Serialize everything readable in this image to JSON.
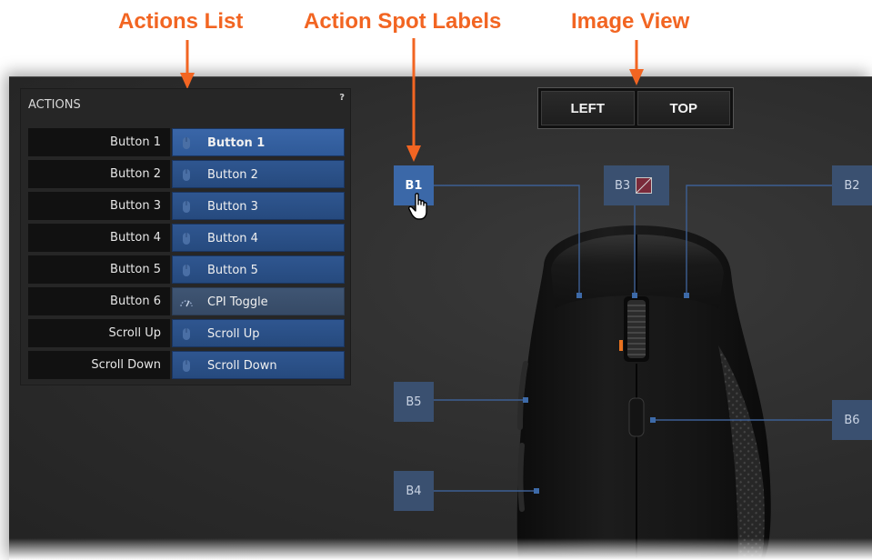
{
  "callouts": {
    "actions_list": "Actions List",
    "action_spot_labels": "Action Spot Labels",
    "image_view": "Image View"
  },
  "actions": {
    "title": "ACTIONS",
    "help": "?",
    "rows": [
      {
        "name": "Button 1",
        "assignment": "Button 1",
        "icon": "mouse-icon"
      },
      {
        "name": "Button 2",
        "assignment": "Button 2",
        "icon": "mouse-icon"
      },
      {
        "name": "Button 3",
        "assignment": "Button 3",
        "icon": "mouse-icon"
      },
      {
        "name": "Button 4",
        "assignment": "Button 4",
        "icon": "mouse-icon"
      },
      {
        "name": "Button 5",
        "assignment": "Button 5",
        "icon": "mouse-icon"
      },
      {
        "name": "Button 6",
        "assignment": "CPI Toggle",
        "icon": "gauge-icon"
      },
      {
        "name": "Scroll Up",
        "assignment": "Scroll Up",
        "icon": "mouse-icon"
      },
      {
        "name": "Scroll Down",
        "assignment": "Scroll Down",
        "icon": "mouse-icon"
      }
    ]
  },
  "view": {
    "left_label": "LEFT",
    "top_label": "TOP"
  },
  "spots": {
    "b1": "B1",
    "b2": "B2",
    "b3": "B3",
    "b4": "B4",
    "b5": "B5",
    "b6": "B6"
  },
  "colors": {
    "callout": "#f26522",
    "accent_blue": "#3b68a8",
    "connector": "#3d5f93"
  }
}
